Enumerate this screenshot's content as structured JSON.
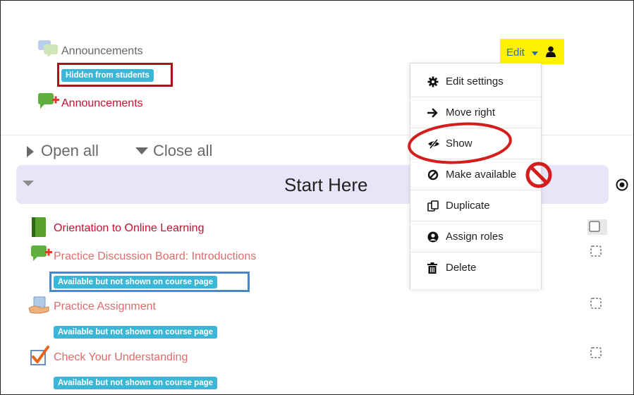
{
  "top": {
    "item1_label": "Announcements",
    "item1_badge": "Hidden from students",
    "item2_label": "Announcements"
  },
  "toggles": {
    "open_all": "Open all",
    "close_all": "Close all"
  },
  "section": {
    "title": "Start Here"
  },
  "edit_menu": {
    "trigger_label": "Edit",
    "items": [
      {
        "label": "Edit settings",
        "icon": "gear-icon"
      },
      {
        "label": "Move right",
        "icon": "arrow-right-icon"
      },
      {
        "label": "Show",
        "icon": "eye-slash-icon"
      },
      {
        "label": "Make available",
        "icon": "ban-icon"
      },
      {
        "label": "Duplicate",
        "icon": "copy-icon"
      },
      {
        "label": "Assign roles",
        "icon": "user-circle-icon"
      },
      {
        "label": "Delete",
        "icon": "trash-icon"
      }
    ]
  },
  "activities": [
    {
      "label": "Orientation to Online Learning",
      "badge": ""
    },
    {
      "label": "Practice Discussion Board: Introductions",
      "badge": "Available but not shown on course page"
    },
    {
      "label": "Practice Assignment",
      "badge": "Available but not shown on course page"
    },
    {
      "label": "Check Your Understanding",
      "badge": "Available but not shown on course page"
    }
  ],
  "colors": {
    "badge": "#3ab7d7",
    "link_red": "#c8102e",
    "link_pink": "#e06b6b",
    "highlight_yellow": "#fff100",
    "section_bg": "#e6e6f8",
    "annotation_red": "#a31818",
    "annotation_blue": "#4a86c8"
  }
}
